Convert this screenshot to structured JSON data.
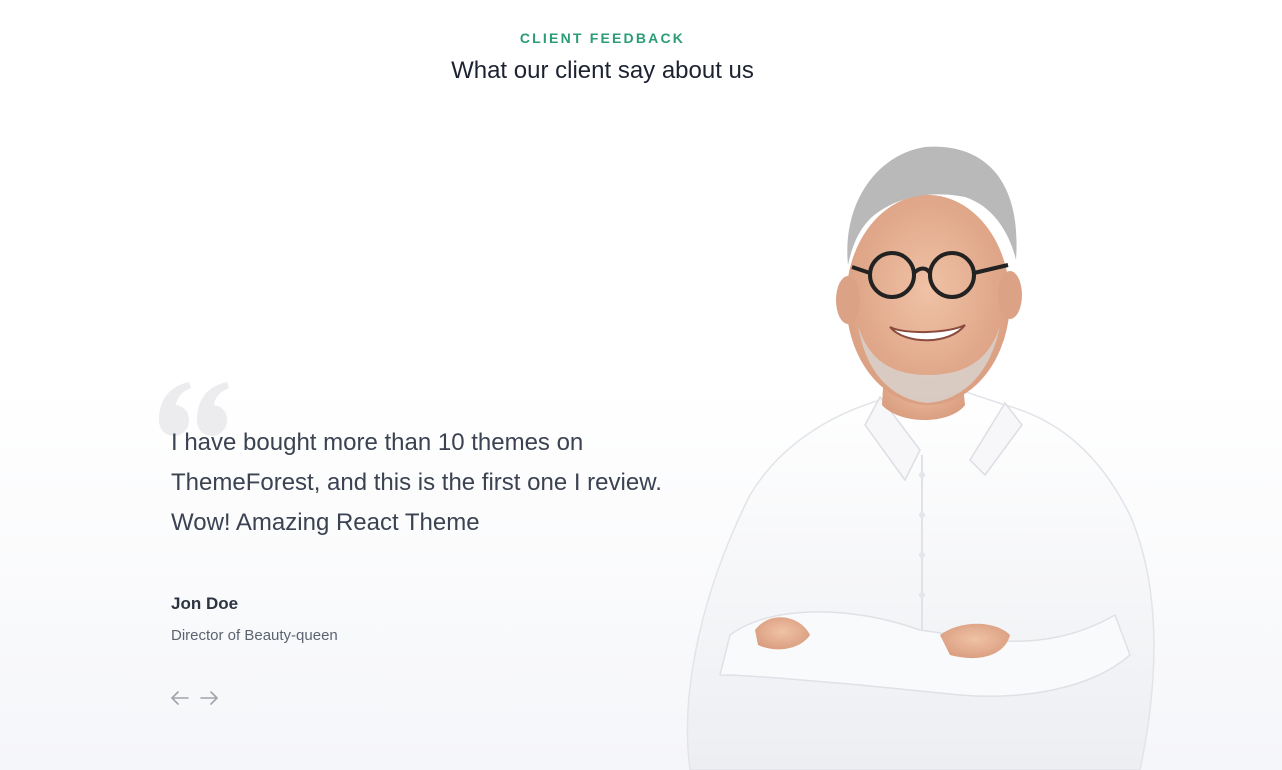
{
  "section": {
    "eyebrow": "CLIENT FEEDBACK",
    "title": "What our client say about us"
  },
  "testimonial": {
    "quote": "I have bought more than 10 themes on ThemeForest, and this is the first one I review. Wow! Amazing React Theme",
    "author_name": "Jon Doe",
    "author_role": "Director of Beauty-queen"
  },
  "navigation": {
    "prev_icon": "arrow-left-icon",
    "next_icon": "arrow-right-icon"
  },
  "colors": {
    "accent": "#2c9c76",
    "heading": "#1c2230",
    "text": "#3b4251",
    "muted": "#5c6370",
    "quote_mark": "#ececef",
    "arrow": "#a0a4ab"
  }
}
